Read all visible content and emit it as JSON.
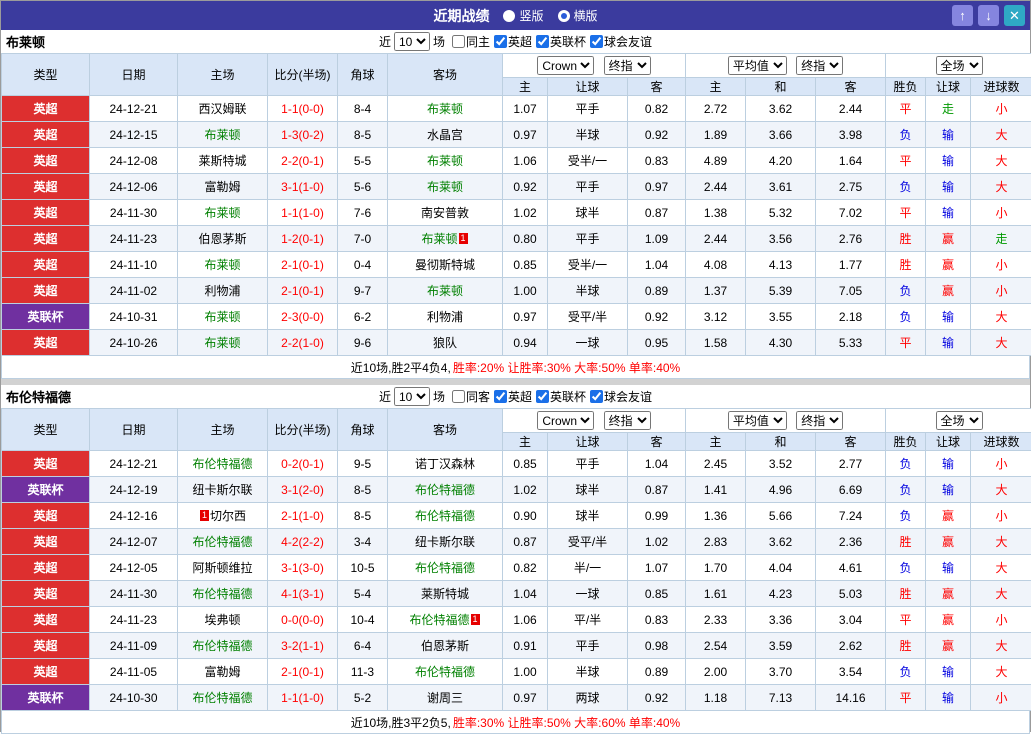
{
  "colors": {
    "bar_purple": "#3b3b9e",
    "epl_red": "#dd2f2f",
    "cup_purple": "#7030a0",
    "focus_green": "#008000",
    "score_red": "#ff0000"
  },
  "topbar": {
    "title": "近期战绩",
    "view_options": [
      {
        "label": "竖版",
        "selected": false
      },
      {
        "label": "横版",
        "selected": true
      }
    ],
    "buttons": {
      "up": "↑",
      "down": "↓",
      "close": "✕"
    }
  },
  "section_controls": {
    "near": "近",
    "count": "10",
    "games": "场"
  },
  "table_header": {
    "static_cols": [
      "类型",
      "日期",
      "主场",
      "比分(半场)",
      "角球",
      "客场"
    ],
    "dropdowns": {
      "odds_source": "Crown",
      "odds_final": "终指",
      "avg_source": "平均值",
      "avg_final": "终指",
      "scope": "全场"
    },
    "sub_cols": [
      "主",
      "让球",
      "客",
      "主",
      "和",
      "客",
      "胜负",
      "让球",
      "进球数"
    ]
  },
  "sections": [
    {
      "team": "布莱顿",
      "checkboxes": [
        {
          "name": "same-home",
          "label": "同主",
          "checked": false
        },
        {
          "name": "league-epl",
          "label": "英超",
          "checked": true
        },
        {
          "name": "league-cup",
          "label": "英联杯",
          "checked": true
        },
        {
          "name": "friendly",
          "label": "球会友谊",
          "checked": true
        }
      ],
      "rows": [
        {
          "league": "英超",
          "league_color": "epl",
          "date": "24-12-21",
          "home": {
            "name": "西汉姆联",
            "is_focus": false
          },
          "score": "1-1(0-0)",
          "corners": "8-4",
          "away": {
            "name": "布莱顿",
            "is_focus": true
          },
          "handicap_odds": [
            "1.07",
            "平手",
            "0.82"
          ],
          "europe_odds": [
            "2.72",
            "3.62",
            "2.44"
          ],
          "results": [
            [
              "平",
              "red"
            ],
            [
              "走",
              "green"
            ],
            [
              "小",
              "red"
            ]
          ]
        },
        {
          "league": "英超",
          "league_color": "epl",
          "date": "24-12-15",
          "home": {
            "name": "布莱顿",
            "is_focus": true
          },
          "score": "1-3(0-2)",
          "corners": "8-5",
          "away": {
            "name": "水晶宫",
            "is_focus": false
          },
          "handicap_odds": [
            "0.97",
            "半球",
            "0.92"
          ],
          "europe_odds": [
            "1.89",
            "3.66",
            "3.98"
          ],
          "results": [
            [
              "负",
              "blue"
            ],
            [
              "输",
              "blue"
            ],
            [
              "大",
              "red"
            ]
          ]
        },
        {
          "league": "英超",
          "league_color": "epl",
          "date": "24-12-08",
          "home": {
            "name": "莱斯特城",
            "is_focus": false
          },
          "score": "2-2(0-1)",
          "corners": "5-5",
          "away": {
            "name": "布莱顿",
            "is_focus": true
          },
          "handicap_odds": [
            "1.06",
            "受半/一",
            "0.83"
          ],
          "europe_odds": [
            "4.89",
            "4.20",
            "1.64"
          ],
          "results": [
            [
              "平",
              "red"
            ],
            [
              "输",
              "blue"
            ],
            [
              "大",
              "red"
            ]
          ]
        },
        {
          "league": "英超",
          "league_color": "epl",
          "date": "24-12-06",
          "home": {
            "name": "富勒姆",
            "is_focus": false
          },
          "score": "3-1(1-0)",
          "corners": "5-6",
          "away": {
            "name": "布莱顿",
            "is_focus": true
          },
          "handicap_odds": [
            "0.92",
            "平手",
            "0.97"
          ],
          "europe_odds": [
            "2.44",
            "3.61",
            "2.75"
          ],
          "results": [
            [
              "负",
              "blue"
            ],
            [
              "输",
              "blue"
            ],
            [
              "大",
              "red"
            ]
          ]
        },
        {
          "league": "英超",
          "league_color": "epl",
          "date": "24-11-30",
          "home": {
            "name": "布莱顿",
            "is_focus": true
          },
          "score": "1-1(1-0)",
          "corners": "7-6",
          "away": {
            "name": "南安普敦",
            "is_focus": false
          },
          "handicap_odds": [
            "1.02",
            "球半",
            "0.87"
          ],
          "europe_odds": [
            "1.38",
            "5.32",
            "7.02"
          ],
          "results": [
            [
              "平",
              "red"
            ],
            [
              "输",
              "blue"
            ],
            [
              "小",
              "red"
            ]
          ]
        },
        {
          "league": "英超",
          "league_color": "epl",
          "date": "24-11-23",
          "home": {
            "name": "伯恩茅斯",
            "is_focus": false
          },
          "score": "1-2(0-1)",
          "corners": "7-0",
          "away": {
            "name": "布莱顿",
            "is_focus": true,
            "badge_after": "1"
          },
          "handicap_odds": [
            "0.80",
            "平手",
            "1.09"
          ],
          "europe_odds": [
            "2.44",
            "3.56",
            "2.76"
          ],
          "results": [
            [
              "胜",
              "red"
            ],
            [
              "赢",
              "red"
            ],
            [
              "走",
              "green"
            ]
          ]
        },
        {
          "league": "英超",
          "league_color": "epl",
          "date": "24-11-10",
          "home": {
            "name": "布莱顿",
            "is_focus": true
          },
          "score": "2-1(0-1)",
          "corners": "0-4",
          "away": {
            "name": "曼彻斯特城",
            "is_focus": false
          },
          "handicap_odds": [
            "0.85",
            "受半/一",
            "1.04"
          ],
          "europe_odds": [
            "4.08",
            "4.13",
            "1.77"
          ],
          "results": [
            [
              "胜",
              "red"
            ],
            [
              "赢",
              "red"
            ],
            [
              "小",
              "red"
            ]
          ]
        },
        {
          "league": "英超",
          "league_color": "epl",
          "date": "24-11-02",
          "home": {
            "name": "利物浦",
            "is_focus": false
          },
          "score": "2-1(0-1)",
          "corners": "9-7",
          "away": {
            "name": "布莱顿",
            "is_focus": true
          },
          "handicap_odds": [
            "1.00",
            "半球",
            "0.89"
          ],
          "europe_odds": [
            "1.37",
            "5.39",
            "7.05"
          ],
          "results": [
            [
              "负",
              "blue"
            ],
            [
              "赢",
              "red"
            ],
            [
              "小",
              "red"
            ]
          ]
        },
        {
          "league": "英联杯",
          "league_color": "cup",
          "date": "24-10-31",
          "home": {
            "name": "布莱顿",
            "is_focus": true
          },
          "score": "2-3(0-0)",
          "corners": "6-2",
          "away": {
            "name": "利物浦",
            "is_focus": false
          },
          "handicap_odds": [
            "0.97",
            "受平/半",
            "0.92"
          ],
          "europe_odds": [
            "3.12",
            "3.55",
            "2.18"
          ],
          "results": [
            [
              "负",
              "blue"
            ],
            [
              "输",
              "blue"
            ],
            [
              "大",
              "red"
            ]
          ]
        },
        {
          "league": "英超",
          "league_color": "epl",
          "date": "24-10-26",
          "home": {
            "name": "布莱顿",
            "is_focus": true
          },
          "score": "2-2(1-0)",
          "corners": "9-6",
          "away": {
            "name": "狼队",
            "is_focus": false
          },
          "handicap_odds": [
            "0.94",
            "一球",
            "0.95"
          ],
          "europe_odds": [
            "1.58",
            "4.30",
            "5.33"
          ],
          "results": [
            [
              "平",
              "red"
            ],
            [
              "输",
              "blue"
            ],
            [
              "大",
              "red"
            ]
          ]
        }
      ],
      "summary": {
        "text": "近10场,胜2平4负4, ",
        "stats": "胜率:20% 让胜率:30% 大率:50% 单率:40%"
      }
    },
    {
      "team": "布伦特福德",
      "checkboxes": [
        {
          "name": "same-away",
          "label": "同客",
          "checked": false
        },
        {
          "name": "league-epl",
          "label": "英超",
          "checked": true
        },
        {
          "name": "league-cup",
          "label": "英联杯",
          "checked": true
        },
        {
          "name": "friendly",
          "label": "球会友谊",
          "checked": true
        }
      ],
      "rows": [
        {
          "league": "英超",
          "league_color": "epl",
          "date": "24-12-21",
          "home": {
            "name": "布伦特福德",
            "is_focus": true
          },
          "score": "0-2(0-1)",
          "corners": "9-5",
          "away": {
            "name": "诺丁汉森林",
            "is_focus": false
          },
          "handicap_odds": [
            "0.85",
            "平手",
            "1.04"
          ],
          "europe_odds": [
            "2.45",
            "3.52",
            "2.77"
          ],
          "results": [
            [
              "负",
              "blue"
            ],
            [
              "输",
              "blue"
            ],
            [
              "小",
              "red"
            ]
          ]
        },
        {
          "league": "英联杯",
          "league_color": "cup",
          "date": "24-12-19",
          "home": {
            "name": "纽卡斯尔联",
            "is_focus": false
          },
          "score": "3-1(2-0)",
          "corners": "8-5",
          "away": {
            "name": "布伦特福德",
            "is_focus": true
          },
          "handicap_odds": [
            "1.02",
            "球半",
            "0.87"
          ],
          "europe_odds": [
            "1.41",
            "4.96",
            "6.69"
          ],
          "results": [
            [
              "负",
              "blue"
            ],
            [
              "输",
              "blue"
            ],
            [
              "大",
              "red"
            ]
          ]
        },
        {
          "league": "英超",
          "league_color": "epl",
          "date": "24-12-16",
          "home": {
            "name": "切尔西",
            "is_focus": false,
            "badge_before": "1"
          },
          "score": "2-1(1-0)",
          "corners": "8-5",
          "away": {
            "name": "布伦特福德",
            "is_focus": true
          },
          "handicap_odds": [
            "0.90",
            "球半",
            "0.99"
          ],
          "europe_odds": [
            "1.36",
            "5.66",
            "7.24"
          ],
          "results": [
            [
              "负",
              "blue"
            ],
            [
              "赢",
              "red"
            ],
            [
              "小",
              "red"
            ]
          ]
        },
        {
          "league": "英超",
          "league_color": "epl",
          "date": "24-12-07",
          "home": {
            "name": "布伦特福德",
            "is_focus": true
          },
          "score": "4-2(2-2)",
          "corners": "3-4",
          "away": {
            "name": "纽卡斯尔联",
            "is_focus": false
          },
          "handicap_odds": [
            "0.87",
            "受平/半",
            "1.02"
          ],
          "europe_odds": [
            "2.83",
            "3.62",
            "2.36"
          ],
          "results": [
            [
              "胜",
              "red"
            ],
            [
              "赢",
              "red"
            ],
            [
              "大",
              "red"
            ]
          ]
        },
        {
          "league": "英超",
          "league_color": "epl",
          "date": "24-12-05",
          "home": {
            "name": "阿斯顿维拉",
            "is_focus": false
          },
          "score": "3-1(3-0)",
          "corners": "10-5",
          "away": {
            "name": "布伦特福德",
            "is_focus": true
          },
          "handicap_odds": [
            "0.82",
            "半/一",
            "1.07"
          ],
          "europe_odds": [
            "1.70",
            "4.04",
            "4.61"
          ],
          "results": [
            [
              "负",
              "blue"
            ],
            [
              "输",
              "blue"
            ],
            [
              "大",
              "red"
            ]
          ]
        },
        {
          "league": "英超",
          "league_color": "epl",
          "date": "24-11-30",
          "home": {
            "name": "布伦特福德",
            "is_focus": true
          },
          "score": "4-1(3-1)",
          "corners": "5-4",
          "away": {
            "name": "莱斯特城",
            "is_focus": false
          },
          "handicap_odds": [
            "1.04",
            "一球",
            "0.85"
          ],
          "europe_odds": [
            "1.61",
            "4.23",
            "5.03"
          ],
          "results": [
            [
              "胜",
              "red"
            ],
            [
              "赢",
              "red"
            ],
            [
              "大",
              "red"
            ]
          ]
        },
        {
          "league": "英超",
          "league_color": "epl",
          "date": "24-11-23",
          "home": {
            "name": "埃弗顿",
            "is_focus": false
          },
          "score": "0-0(0-0)",
          "corners": "10-4",
          "away": {
            "name": "布伦特福德",
            "is_focus": true,
            "badge_after": "1"
          },
          "handicap_odds": [
            "1.06",
            "平/半",
            "0.83"
          ],
          "europe_odds": [
            "2.33",
            "3.36",
            "3.04"
          ],
          "results": [
            [
              "平",
              "red"
            ],
            [
              "赢",
              "red"
            ],
            [
              "小",
              "red"
            ]
          ]
        },
        {
          "league": "英超",
          "league_color": "epl",
          "date": "24-11-09",
          "home": {
            "name": "布伦特福德",
            "is_focus": true
          },
          "score": "3-2(1-1)",
          "corners": "6-4",
          "away": {
            "name": "伯恩茅斯",
            "is_focus": false
          },
          "handicap_odds": [
            "0.91",
            "平手",
            "0.98"
          ],
          "europe_odds": [
            "2.54",
            "3.59",
            "2.62"
          ],
          "results": [
            [
              "胜",
              "red"
            ],
            [
              "赢",
              "red"
            ],
            [
              "大",
              "red"
            ]
          ]
        },
        {
          "league": "英超",
          "league_color": "epl",
          "date": "24-11-05",
          "home": {
            "name": "富勒姆",
            "is_focus": false
          },
          "score": "2-1(0-1)",
          "corners": "11-3",
          "away": {
            "name": "布伦特福德",
            "is_focus": true
          },
          "handicap_odds": [
            "1.00",
            "半球",
            "0.89"
          ],
          "europe_odds": [
            "2.00",
            "3.70",
            "3.54"
          ],
          "results": [
            [
              "负",
              "blue"
            ],
            [
              "输",
              "blue"
            ],
            [
              "大",
              "red"
            ]
          ]
        },
        {
          "league": "英联杯",
          "league_color": "cup",
          "date": "24-10-30",
          "home": {
            "name": "布伦特福德",
            "is_focus": true
          },
          "score": "1-1(1-0)",
          "corners": "5-2",
          "away": {
            "name": "谢周三",
            "is_focus": false
          },
          "handicap_odds": [
            "0.97",
            "两球",
            "0.92"
          ],
          "europe_odds": [
            "1.18",
            "7.13",
            "14.16"
          ],
          "results": [
            [
              "平",
              "red"
            ],
            [
              "输",
              "blue"
            ],
            [
              "小",
              "red"
            ]
          ]
        }
      ],
      "summary": {
        "text": "近10场,胜3平2负5, ",
        "stats": "胜率:30% 让胜率:50% 大率:60% 单率:40%"
      }
    }
  ]
}
